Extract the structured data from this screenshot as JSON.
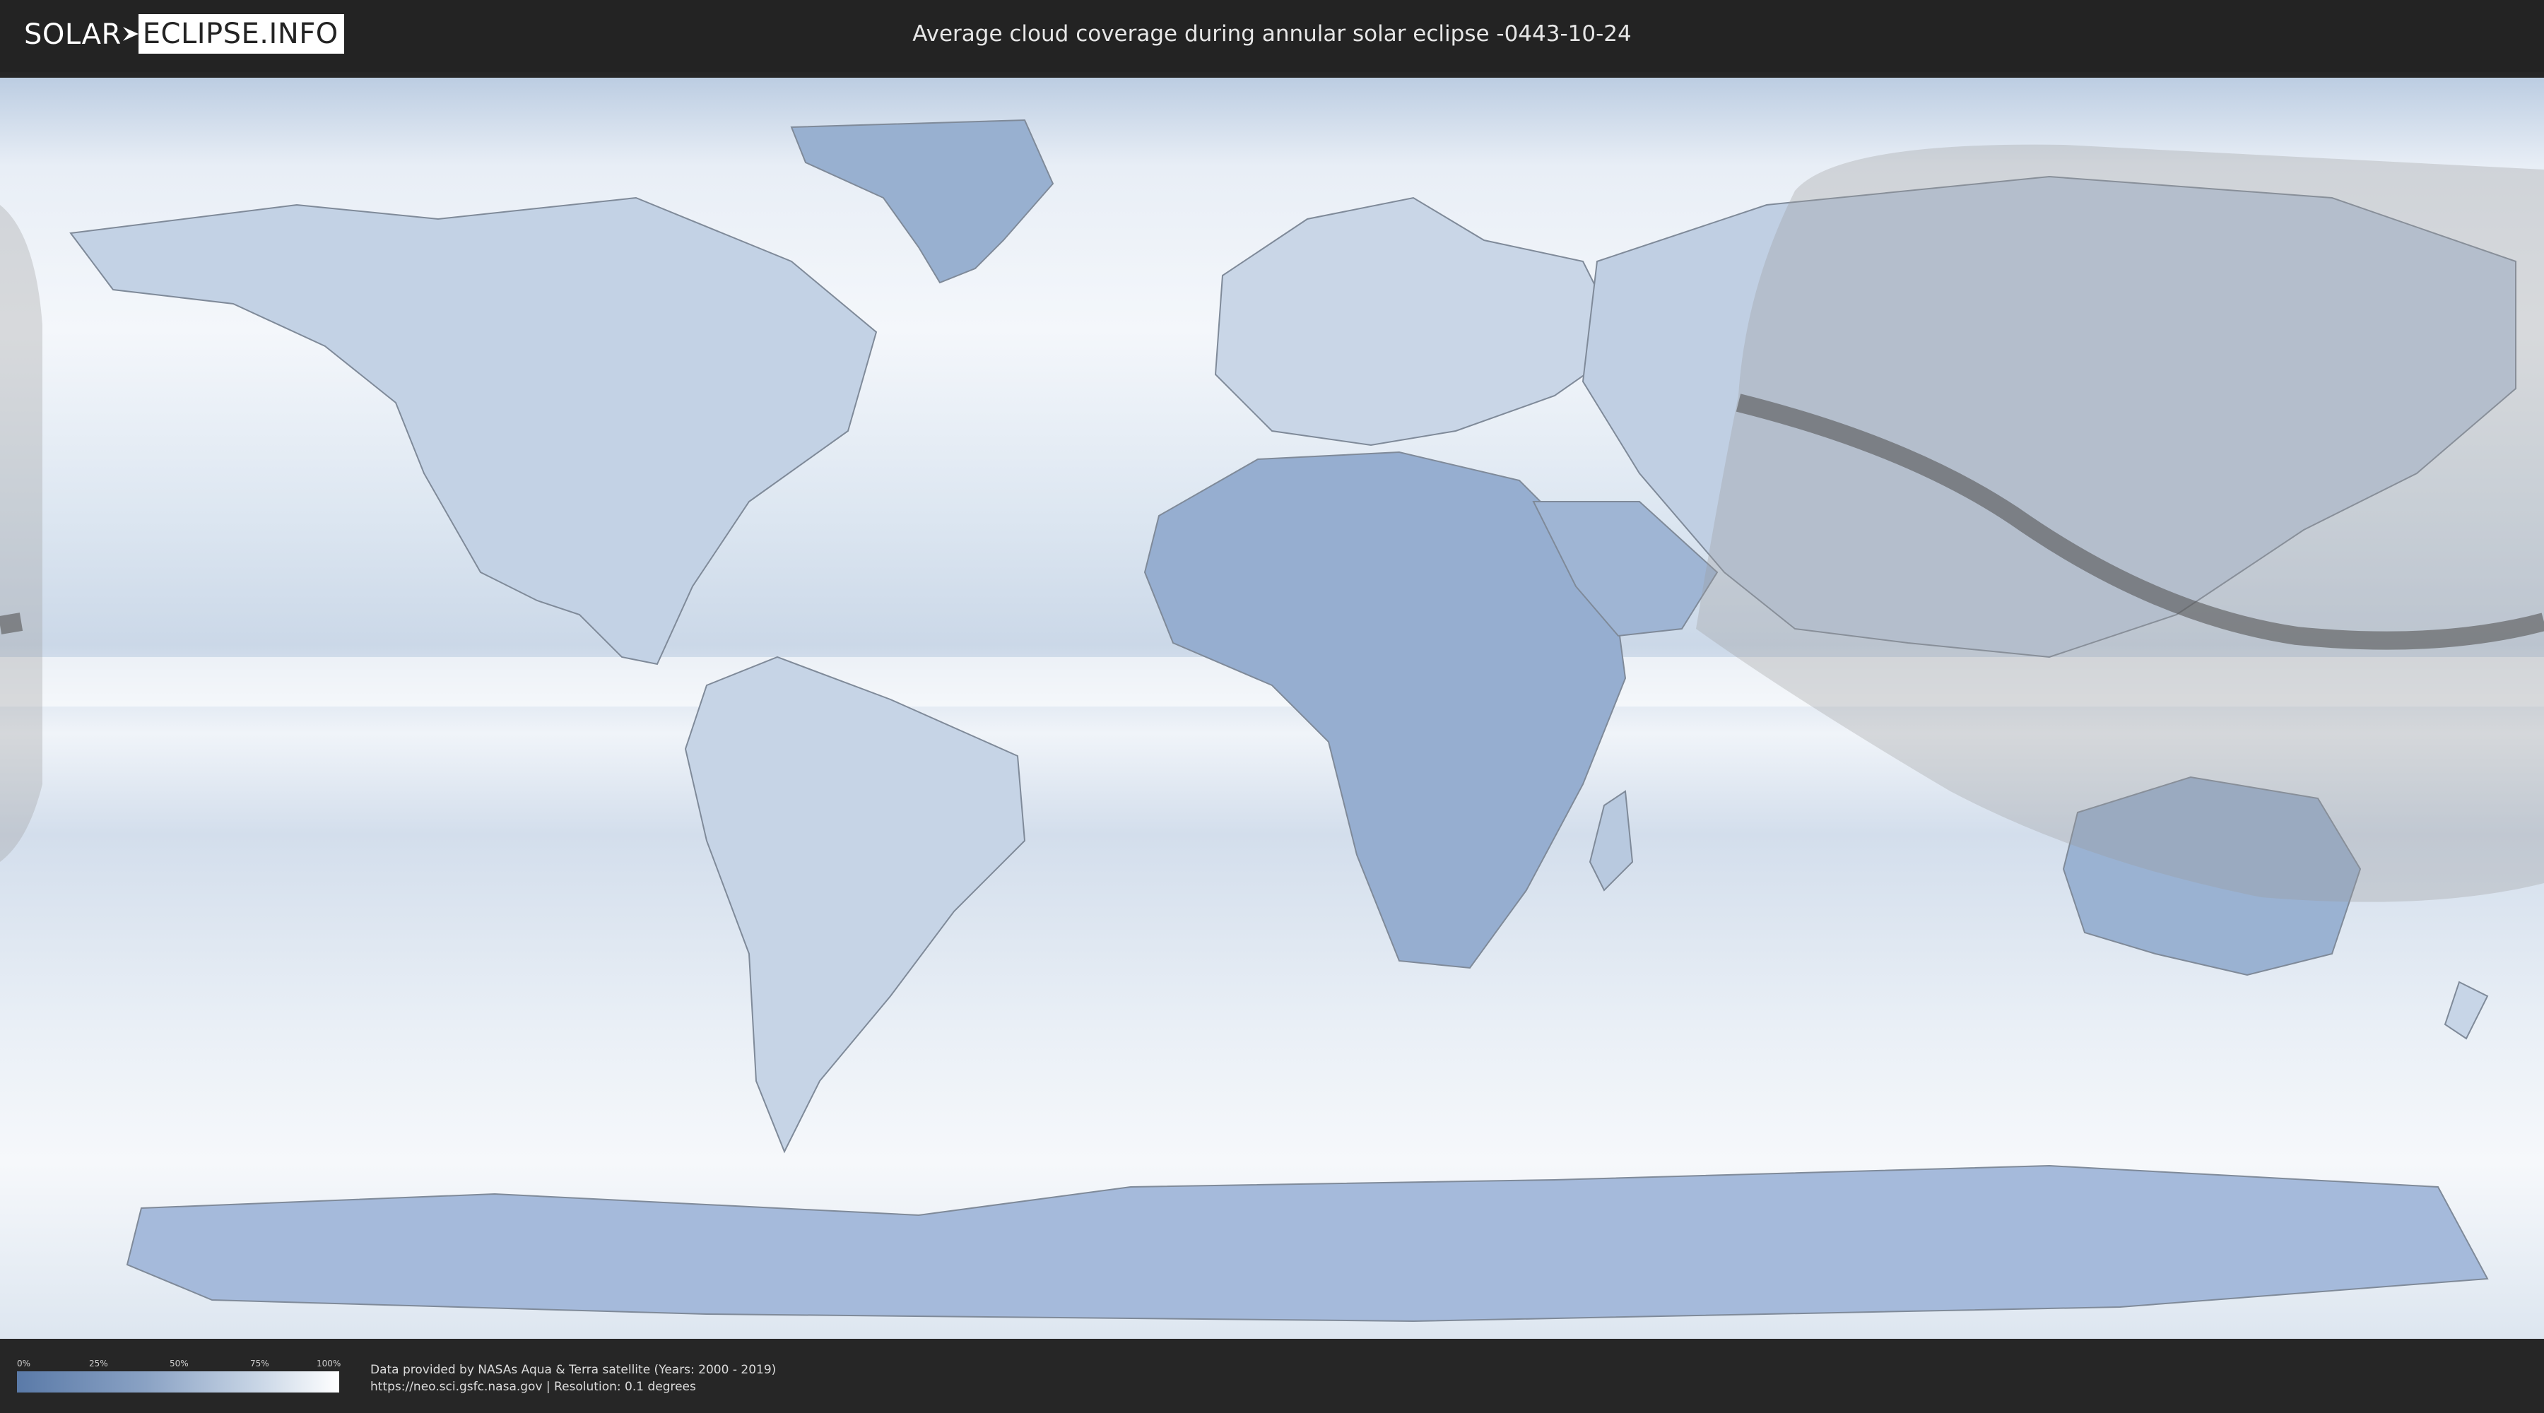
{
  "header": {
    "logo_left": "SOLAR",
    "logo_right": "ECLIPSE.INFO",
    "title": "Average cloud coverage during annular solar eclipse -0443-10-24"
  },
  "map": {
    "layer": "average cloud coverage",
    "icons": {
      "penumbra": "eclipse-visibility-region",
      "path": "annularity-path"
    },
    "colors": {
      "clear": "#5a7aa8",
      "cloudy": "#ffffff",
      "land_outline": "#7f8a99",
      "eclipse_shadow": "#8f8f8f",
      "annular_path": "#555555"
    }
  },
  "legend": {
    "ticks": [
      "0%",
      "25%",
      "50%",
      "75%",
      "100%"
    ]
  },
  "credits": {
    "line1": "Data provided by NASAs Aqua & Terra satellite (Years: 2000 - 2019)",
    "line2": "https://neo.sci.gsfc.nasa.gov | Resolution: 0.1 degrees"
  }
}
